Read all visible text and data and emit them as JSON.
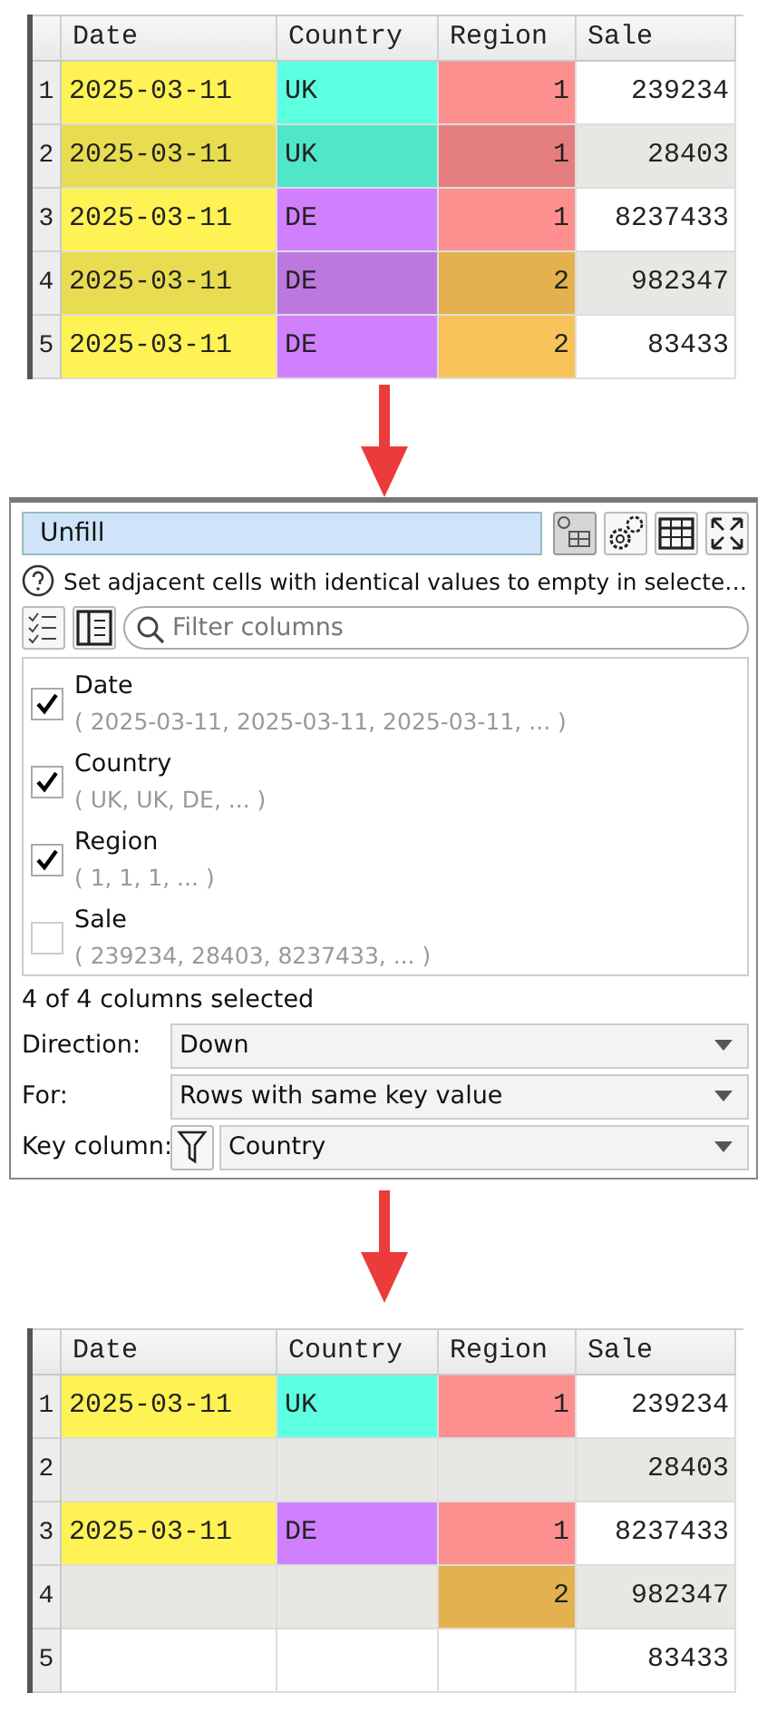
{
  "before_table": {
    "columns": [
      {
        "label": "Date",
        "kind": "text"
      },
      {
        "label": "Country",
        "kind": "text"
      },
      {
        "label": "Region",
        "kind": "number"
      },
      {
        "label": "Sale",
        "kind": "number"
      }
    ],
    "rows": [
      {
        "number": "1",
        "cells": [
          {
            "text": "2025-03-11",
            "color": "#fef255"
          },
          {
            "text": "UK",
            "color": "#5cffe0"
          },
          {
            "text": "1",
            "color": "#fd8f8f"
          },
          {
            "text": "239234",
            "color": "#ffffff"
          }
        ]
      },
      {
        "number": "2",
        "cells": [
          {
            "text": "2025-03-11",
            "color": "#e8dd50"
          },
          {
            "text": "UK",
            "color": "#50e6c8"
          },
          {
            "text": "1",
            "color": "#e57e7e"
          },
          {
            "text": "28403",
            "color": "#e8e7e4"
          }
        ]
      },
      {
        "number": "3",
        "cells": [
          {
            "text": "2025-03-11",
            "color": "#fef255"
          },
          {
            "text": "DE",
            "color": "#d080fd"
          },
          {
            "text": "1",
            "color": "#fd8f8f"
          },
          {
            "text": "8237433",
            "color": "#ffffff"
          }
        ]
      },
      {
        "number": "4",
        "cells": [
          {
            "text": "2025-03-11",
            "color": "#e8dd50"
          },
          {
            "text": "DE",
            "color": "#bd78e0"
          },
          {
            "text": "2",
            "color": "#e4b14f"
          },
          {
            "text": "982347",
            "color": "#e8e7e4"
          }
        ]
      },
      {
        "number": "5",
        "cells": [
          {
            "text": "2025-03-11",
            "color": "#fef255"
          },
          {
            "text": "DE",
            "color": "#d080fd"
          },
          {
            "text": "2",
            "color": "#f8c45a"
          },
          {
            "text": "83433",
            "color": "#ffffff"
          }
        ]
      }
    ]
  },
  "unfill_panel": {
    "title": "Unfill",
    "toolbar_buttons": [
      {
        "kind": "formula",
        "pressed": true
      },
      {
        "kind": "settings",
        "pressed": false
      },
      {
        "kind": "table",
        "pressed": false
      },
      {
        "kind": "expand",
        "pressed": false
      }
    ],
    "help_text": "Set adjacent cells with identical values to empty in selecte…",
    "list_buttons": [
      {
        "kind": "checklist"
      },
      {
        "kind": "panel"
      }
    ],
    "filter": {
      "placeholder": "Filter columns"
    },
    "columns": [
      {
        "name": "Date",
        "preview": "( 2025-03-11, 2025-03-11, 2025-03-11, ... )",
        "checked": true
      },
      {
        "name": "Country",
        "preview": "( UK, UK, DE, ... )",
        "checked": true
      },
      {
        "name": "Region",
        "preview": "( 1, 1, 1, ... )",
        "checked": true
      },
      {
        "name": "Sale",
        "preview": "( 239234, 28403, 8237433, ... )",
        "checked": false
      }
    ],
    "status": "4 of 4 columns selected",
    "options": [
      {
        "kind": "choice",
        "label": "Direction:",
        "value": "Down"
      },
      {
        "kind": "choice",
        "label": "For:",
        "value": "Rows with same key value"
      },
      {
        "kind": "column",
        "label": "Key column:",
        "value": "Country"
      }
    ]
  },
  "after_table": {
    "columns": [
      {
        "label": "Date",
        "kind": "text"
      },
      {
        "label": "Country",
        "kind": "text"
      },
      {
        "label": "Region",
        "kind": "number"
      },
      {
        "label": "Sale",
        "kind": "number"
      }
    ],
    "rows": [
      {
        "number": "1",
        "cells": [
          {
            "text": "2025-03-11",
            "color": "#fef255"
          },
          {
            "text": "UK",
            "color": "#5cffe0"
          },
          {
            "text": "1",
            "color": "#fd8f8f"
          },
          {
            "text": "239234",
            "color": "#ffffff"
          }
        ]
      },
      {
        "number": "2",
        "cells": [
          {
            "color": "#e8e7e4"
          },
          {
            "color": "#e8e7e4"
          },
          {
            "color": "#e8e7e4"
          },
          {
            "text": "28403",
            "color": "#e8e7e4"
          }
        ]
      },
      {
        "number": "3",
        "cells": [
          {
            "text": "2025-03-11",
            "color": "#fef255"
          },
          {
            "text": "DE",
            "color": "#d080fd"
          },
          {
            "text": "1",
            "color": "#fd8f8f"
          },
          {
            "text": "8237433",
            "color": "#ffffff"
          }
        ]
      },
      {
        "number": "4",
        "cells": [
          {
            "color": "#e8e7e4"
          },
          {
            "color": "#e8e7e4"
          },
          {
            "text": "2",
            "color": "#e4b14f"
          },
          {
            "text": "982347",
            "color": "#e8e7e4"
          }
        ]
      },
      {
        "number": "5",
        "cells": [
          {
            "color": "#ffffff"
          },
          {
            "color": "#ffffff"
          },
          {
            "color": "#ffffff"
          },
          {
            "text": "83433",
            "color": "#ffffff"
          }
        ]
      }
    ]
  }
}
